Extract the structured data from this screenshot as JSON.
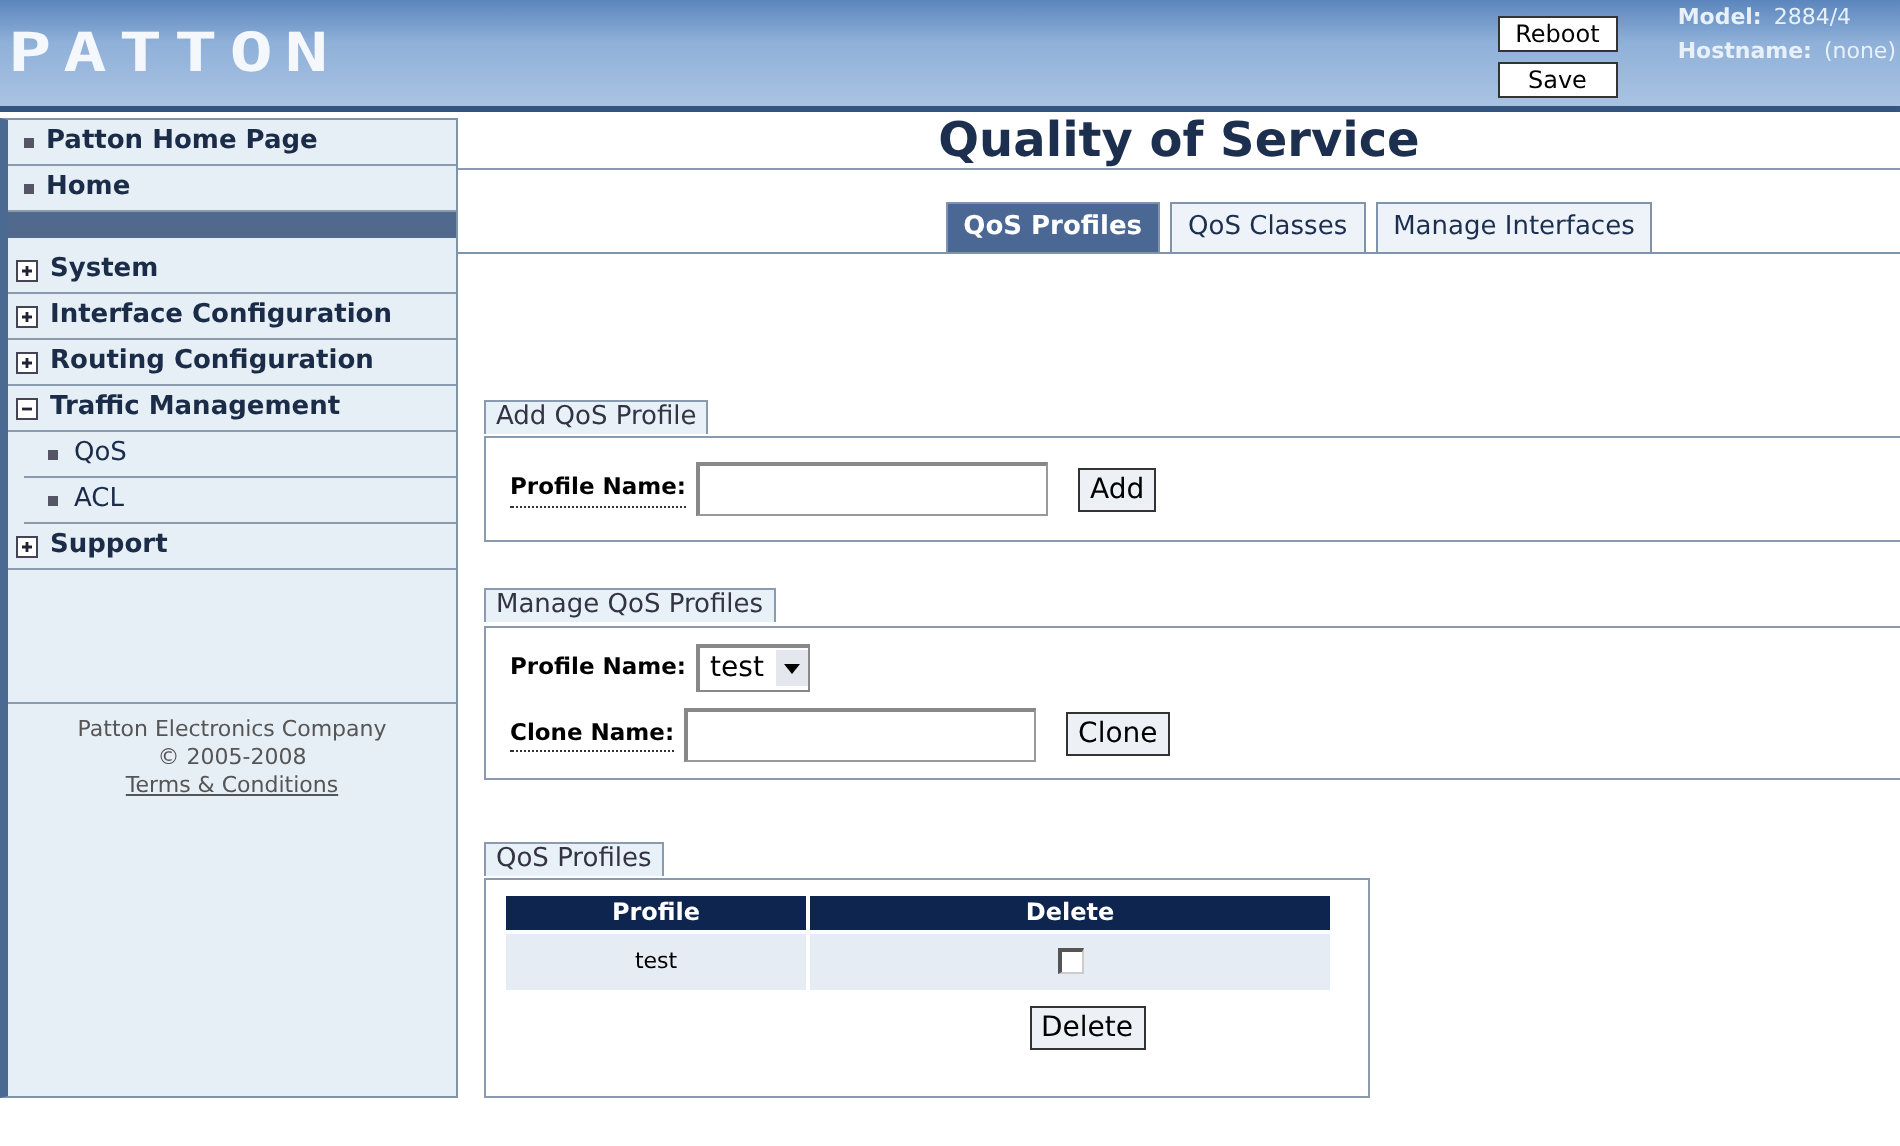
{
  "header": {
    "logo": "PATTON",
    "buttons": [
      "Reboot",
      "Save"
    ],
    "info": [
      {
        "label": "Model:",
        "value": "2884/4"
      },
      {
        "label": "Hostname:",
        "value": "(none)"
      }
    ]
  },
  "sidebar": {
    "links": [
      "Patton Home Page",
      "Home"
    ],
    "menu": [
      {
        "label": "System",
        "expanded": false
      },
      {
        "label": "Interface Configuration",
        "expanded": false
      },
      {
        "label": "Routing Configuration",
        "expanded": false
      },
      {
        "label": "Traffic Management",
        "expanded": true,
        "children": [
          {
            "label": "QoS"
          },
          {
            "label": "ACL"
          }
        ]
      },
      {
        "label": "Support",
        "expanded": false
      }
    ],
    "footer": {
      "company": "Patton Electronics Company",
      "copyright": "© 2005-2008",
      "link": "Terms & Conditions"
    }
  },
  "page": {
    "title": "Quality of Service",
    "tabs": [
      {
        "label": "QoS Profiles",
        "selected": true
      },
      {
        "label": "QoS Classes",
        "selected": false
      },
      {
        "label": "Manage Interfaces",
        "selected": false
      }
    ],
    "add_profile": {
      "legend": "Add QoS Profile",
      "label": "Profile Name:",
      "button": "Add"
    },
    "manage_profiles": {
      "legend": "Manage QoS Profiles",
      "profile_label": "Profile Name:",
      "profile_value": "test",
      "clone_label": "Clone Name:",
      "button": "Clone"
    },
    "profiles": {
      "legend": "QoS Profiles",
      "columns": [
        "Profile",
        "Delete"
      ],
      "rows": [
        {
          "profile": "test",
          "checked": false
        }
      ],
      "button": "Delete"
    }
  }
}
